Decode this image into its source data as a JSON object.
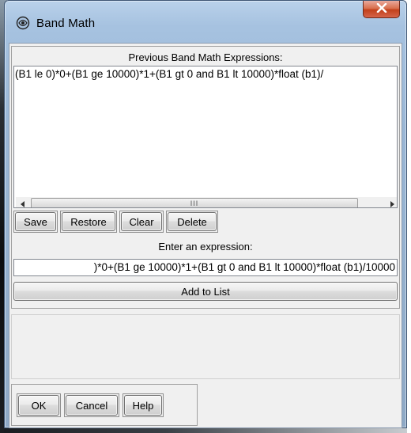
{
  "window": {
    "title": "Band Math",
    "close_glyph": "x",
    "icon": "band-math-app-icon"
  },
  "previous": {
    "label": "Previous Band Math Expressions:",
    "items": [
      "(B1 le 0)*0+(B1 ge 10000)*1+(B1 gt 0 and B1 lt 10000)*float (b1)/"
    ]
  },
  "scrollbar": {
    "left_arrow": "◄",
    "right_arrow": "►",
    "grip": "III"
  },
  "list_buttons": {
    "save": "Save",
    "restore": "Restore",
    "clear": "Clear",
    "delete": "Delete"
  },
  "expression": {
    "label": "Enter an expression:",
    "value": ")*0+(B1 ge 10000)*1+(B1 gt 0 and B1 lt 10000)*float (b1)/10000"
  },
  "add_button": "Add to List",
  "footer_buttons": {
    "ok": "OK",
    "cancel": "Cancel",
    "help": "Help"
  },
  "colors": {
    "title_bar": "#a6c2e0",
    "close_button": "#c2401b",
    "dialog_face": "#f0f0f0"
  }
}
